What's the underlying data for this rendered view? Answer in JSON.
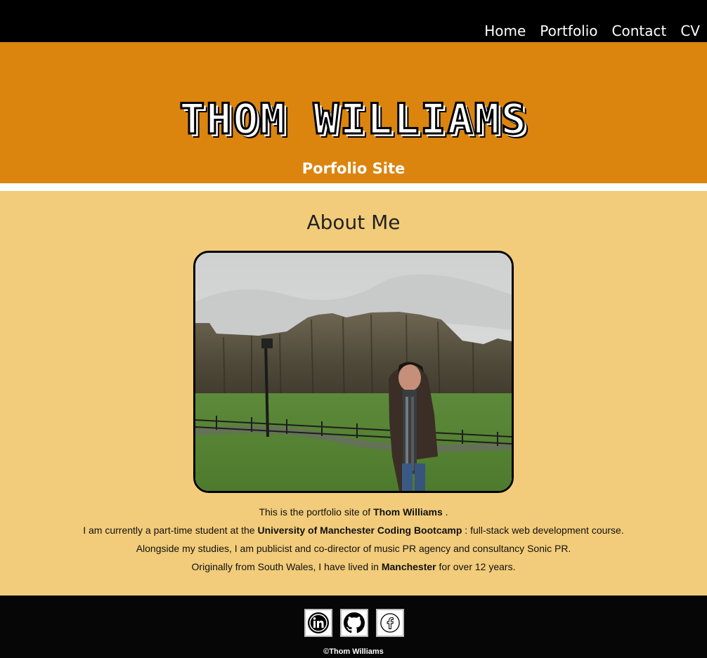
{
  "nav": {
    "items": [
      {
        "label": "Home"
      },
      {
        "label": "Portfolio"
      },
      {
        "label": "Contact"
      },
      {
        "label": "CV"
      }
    ]
  },
  "hero": {
    "title": "Thom Williams",
    "subtitle": "Porfolio Site"
  },
  "about": {
    "heading": "About Me",
    "lines": [
      {
        "a": "This is the portfolio site of ",
        "b": "Thom Williams",
        "c": " ."
      },
      {
        "a": "I am currently a part-time student at the ",
        "b": "University of Manchester Coding Bootcamp",
        "c": " : full-stack web development course."
      },
      {
        "a": "Alongside my studies, I am publicist and co-director of music PR agency and consultancy Sonic PR.",
        "b": "",
        "c": ""
      },
      {
        "a": "Originally from South Wales, I have lived in ",
        "b": "Manchester",
        "c": " for over 12 years."
      }
    ]
  },
  "footer": {
    "socials": [
      {
        "icon": "linkedin-icon"
      },
      {
        "icon": "github-icon"
      },
      {
        "icon": "facebook-icon"
      }
    ],
    "copyright": "©Thom Williams"
  },
  "colors": {
    "hero_bg": "#db850f",
    "about_bg": "#f2cc7a",
    "nav_bg": "#000000"
  }
}
